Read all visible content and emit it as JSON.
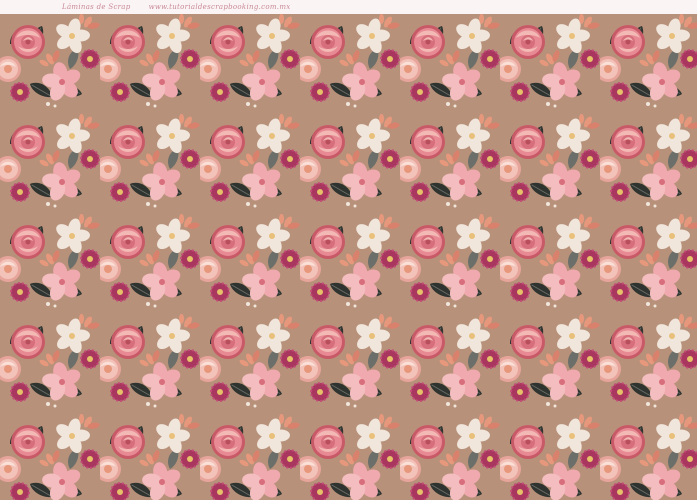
{
  "header": {
    "left_text": "Láminas de Scrap",
    "right_text": "www.tutorialdescrapbooking.com.mx"
  },
  "pattern": {
    "background_color": "#b8917a",
    "flower_colors": {
      "rose_pink": "#e88a93",
      "rose_deep": "#c85a68",
      "blush": "#f3b9b4",
      "cream": "#f1e6dc",
      "magenta": "#a8365e",
      "coral": "#e7987c",
      "leaf_dark": "#2f3430",
      "leaf_gray": "#6c6f69"
    }
  }
}
